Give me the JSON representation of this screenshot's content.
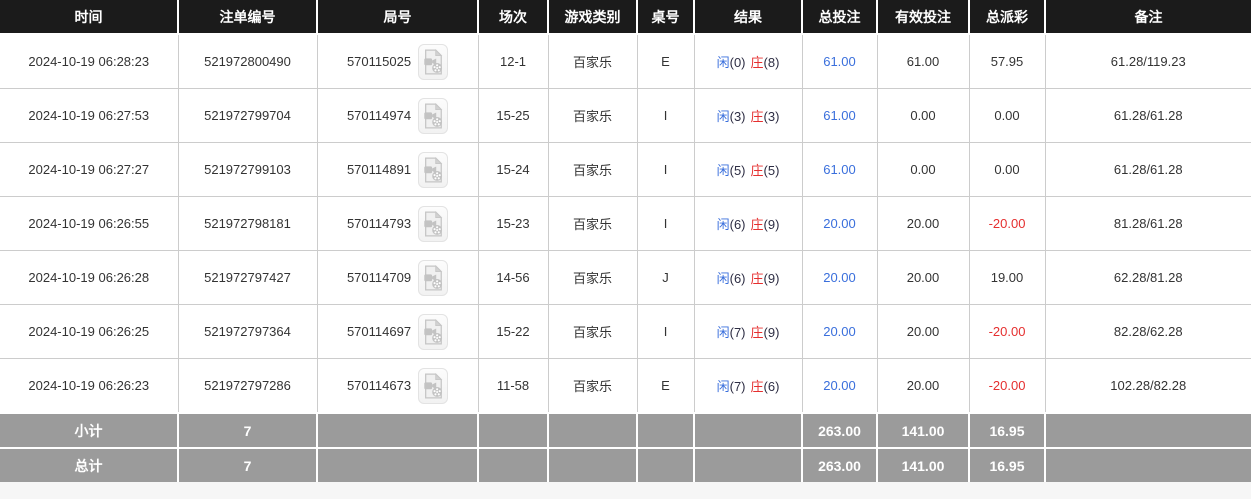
{
  "colors": {
    "header_bg": "#1b1b1b",
    "footer_bg": "#9b9b9b",
    "blue": "#3a6fdc",
    "red": "#e52f2f",
    "text": "#333333",
    "border": "#cccccc"
  },
  "table": {
    "columns": [
      {
        "label": "时间"
      },
      {
        "label": "注单编号"
      },
      {
        "label": "局号"
      },
      {
        "label": "场次"
      },
      {
        "label": "游戏类别"
      },
      {
        "label": "桌号"
      },
      {
        "label": "结果"
      },
      {
        "label": "总投注"
      },
      {
        "label": "有效投注"
      },
      {
        "label": "总派彩"
      },
      {
        "label": "备注"
      }
    ],
    "rows": [
      {
        "time": "2024-10-19 06:28:23",
        "bet_id": "521972800490",
        "round_id": "570115025",
        "session": "12-1",
        "game": "百家乐",
        "table_no": "E",
        "result": {
          "p": "闲",
          "pn": "(0)",
          "b": "庄",
          "bn": "(8)"
        },
        "total": "61.00",
        "valid": "61.00",
        "payout": "57.95",
        "remark": "61.28/119.23"
      },
      {
        "time": "2024-10-19 06:27:53",
        "bet_id": "521972799704",
        "round_id": "570114974",
        "session": "15-25",
        "game": "百家乐",
        "table_no": "I",
        "result": {
          "p": "闲",
          "pn": "(3)",
          "b": "庄",
          "bn": "(3)"
        },
        "total": "61.00",
        "valid": "0.00",
        "payout": "0.00",
        "remark": "61.28/61.28"
      },
      {
        "time": "2024-10-19 06:27:27",
        "bet_id": "521972799103",
        "round_id": "570114891",
        "session": "15-24",
        "game": "百家乐",
        "table_no": "I",
        "result": {
          "p": "闲",
          "pn": "(5)",
          "b": "庄",
          "bn": "(5)"
        },
        "total": "61.00",
        "valid": "0.00",
        "payout": "0.00",
        "remark": "61.28/61.28"
      },
      {
        "time": "2024-10-19 06:26:55",
        "bet_id": "521972798181",
        "round_id": "570114793",
        "session": "15-23",
        "game": "百家乐",
        "table_no": "I",
        "result": {
          "p": "闲",
          "pn": "(6)",
          "b": "庄",
          "bn": "(9)"
        },
        "total": "20.00",
        "valid": "20.00",
        "payout": "-20.00",
        "remark": "81.28/61.28"
      },
      {
        "time": "2024-10-19 06:26:28",
        "bet_id": "521972797427",
        "round_id": "570114709",
        "session": "14-56",
        "game": "百家乐",
        "table_no": "J",
        "result": {
          "p": "闲",
          "pn": "(6)",
          "b": "庄",
          "bn": "(9)"
        },
        "total": "20.00",
        "valid": "20.00",
        "payout": "19.00",
        "remark": "62.28/81.28"
      },
      {
        "time": "2024-10-19 06:26:25",
        "bet_id": "521972797364",
        "round_id": "570114697",
        "session": "15-22",
        "game": "百家乐",
        "table_no": "I",
        "result": {
          "p": "闲",
          "pn": "(7)",
          "b": "庄",
          "bn": "(9)"
        },
        "total": "20.00",
        "valid": "20.00",
        "payout": "-20.00",
        "remark": "82.28/62.28"
      },
      {
        "time": "2024-10-19 06:26:23",
        "bet_id": "521972797286",
        "round_id": "570114673",
        "session": "11-58",
        "game": "百家乐",
        "table_no": "E",
        "result": {
          "p": "闲",
          "pn": "(7)",
          "b": "庄",
          "bn": "(6)"
        },
        "total": "20.00",
        "valid": "20.00",
        "payout": "-20.00",
        "remark": "102.28/82.28"
      }
    ],
    "footer": [
      {
        "label": "小计",
        "count": "7",
        "total": "263.00",
        "valid": "141.00",
        "payout": "16.95"
      },
      {
        "label": "总计",
        "count": "7",
        "total": "263.00",
        "valid": "141.00",
        "payout": "16.95"
      }
    ]
  },
  "icons": {
    "video": "video-record-icon"
  }
}
